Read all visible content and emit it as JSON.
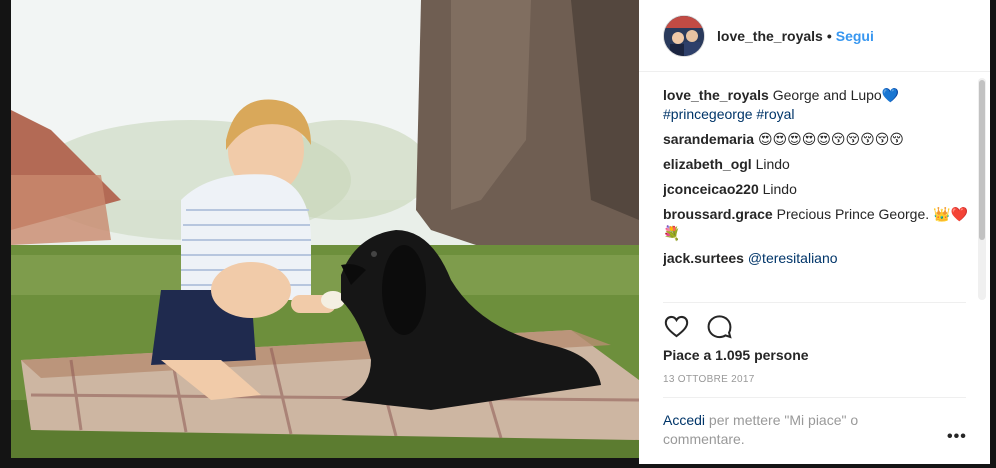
{
  "post": {
    "username": "love_the_royals",
    "separator": "•",
    "follow_label": "Segui"
  },
  "comments": [
    {
      "user": "love_the_royals",
      "text": "George and Lupo💙",
      "tags": "#princegeorge #royal"
    },
    {
      "user": "sarandemaria",
      "text": "😍😍😍😍😍😚😚😚😚😚"
    },
    {
      "user": "elizabeth_ogl",
      "text": "Lindo"
    },
    {
      "user": "jconceicao220",
      "text": "Lindo"
    },
    {
      "user": "broussard.grace",
      "text": "Precious Prince George. 👑❤️💐"
    },
    {
      "user": "jack.surtees",
      "text": "@teresitaliano"
    }
  ],
  "stats": {
    "likes": "Piace a 1.095 persone",
    "date": "13 OTTOBRE 2017"
  },
  "footer": {
    "login_link": "Accedi",
    "login_text": " per mettere \"Mi piace\" o commentare.",
    "more": "•••"
  },
  "icons": {
    "like": "heart-icon",
    "comment": "comment-icon",
    "more": "more-options-icon"
  },
  "colors": {
    "follow": "#3897f0",
    "hashtag": "#003569",
    "muted": "#999999",
    "text": "#262626"
  }
}
